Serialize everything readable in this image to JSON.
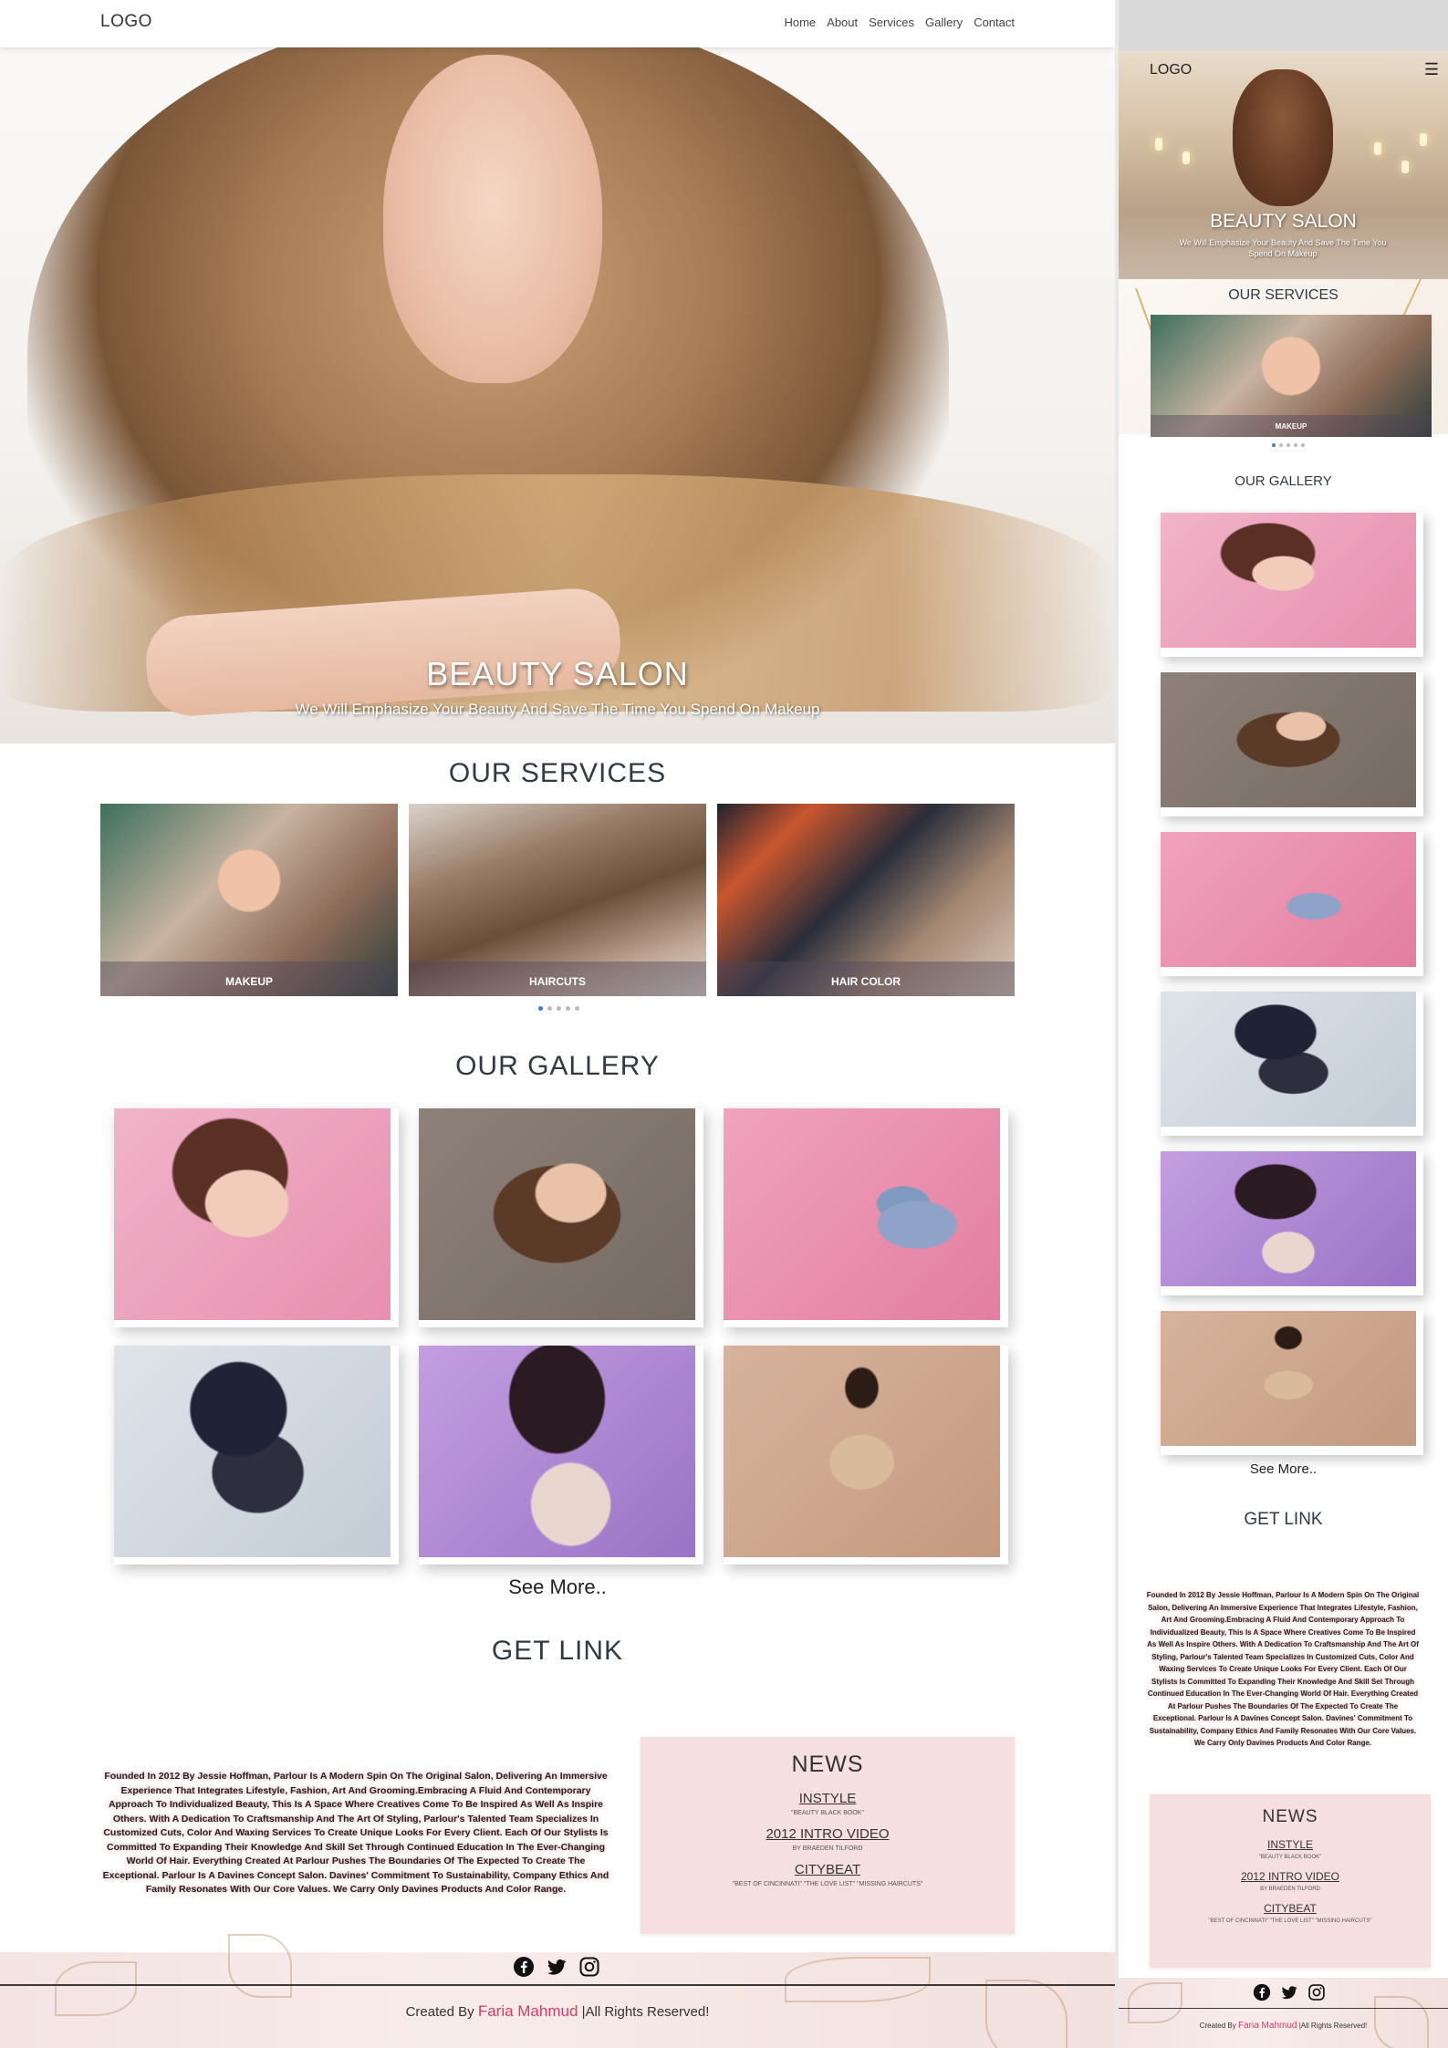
{
  "desktop": {
    "nav": {
      "logo": "LOGO",
      "items": [
        "Home",
        "About",
        "Services",
        "Gallery",
        "Contact"
      ]
    },
    "hero": {
      "title": "BEAUTY SALON",
      "subtitle": "We Will Emphasize Your Beauty And Save The Time You Spend On Makeup"
    },
    "services": {
      "title": "OUR SERVICES",
      "cards": [
        "MAKEUP",
        "HAIRCUTS",
        "HAIR COLOR"
      ],
      "carousel_dots": 5,
      "active_dot": 0
    },
    "gallery": {
      "title": "OUR GALLERY",
      "see_more": "See More.."
    },
    "get_link": {
      "title": "GET LINK",
      "about": "Founded In 2012 By Jessie Hoffman, Parlour Is A Modern Spin On The Original Salon, Delivering An Immersive Experience That Integrates Lifestyle, Fashion, Art And Grooming.Embracing A Fluid And Contemporary Approach To Individualized Beauty, This Is A Space Where Creatives Come To Be Inspired As Well As Inspire Others. With A Dedication To Craftsmanship And The Art Of Styling, Parlour's Talented Team Specializes In Customized Cuts, Color And Waxing Services To Create Unique Looks For Every Client. Each Of Our Stylists Is Committed To Expanding Their Knowledge And Skill Set Through Continued Education In The Ever-Changing World Of Hair. Everything Created At Parlour Pushes The Boundaries Of The Expected To Create The Exceptional. Parlour Is A Davines Concept Salon. Davines' Commitment To Sustainability, Company Ethics And Family Resonates With Our Core Values. We Carry Only Davines Products And Color Range."
    },
    "news": {
      "title": "NEWS",
      "items": [
        {
          "title": "INSTYLE",
          "sub": "\"BEAUTY BLACK BOOK\""
        },
        {
          "title": "2012 INTRO VIDEO",
          "sub": "BY BRAEDEN TILFORD"
        },
        {
          "title": "CITYBEAT",
          "sub": "\"BEST OF CINCINNATI\" \"THE LOVE LIST\" \"MISSING HAIRCUTS\""
        }
      ]
    },
    "footer": {
      "credit_prefix": "Created By",
      "credit_name": "Faria Mahmud",
      "credit_suffix": "|All Rights Reserved!"
    }
  },
  "mobile": {
    "nav": {
      "logo": "LOGO",
      "menu_icon": "☰"
    },
    "hero": {
      "title": "BEAUTY SALON",
      "subtitle": "We Will Emphasize Your Beauty And Save The Time You Spend On Makeup"
    },
    "services": {
      "title": "OUR SERVICES",
      "card": "MAKEUP",
      "carousel_dots": 5,
      "active_dot": 0
    },
    "gallery": {
      "title": "OUR GALLERY",
      "see_more": "See More.."
    },
    "get_link": {
      "title": "GET LINK"
    },
    "news": {
      "title": "NEWS"
    }
  },
  "social_icons": [
    "facebook-icon",
    "twitter-icon",
    "instagram-icon"
  ],
  "colors": {
    "news_bg": "#f5dfe1",
    "credit_name": "#d63a6a",
    "active_dot": "#3a7bd5",
    "heading": "#2f3a44"
  }
}
